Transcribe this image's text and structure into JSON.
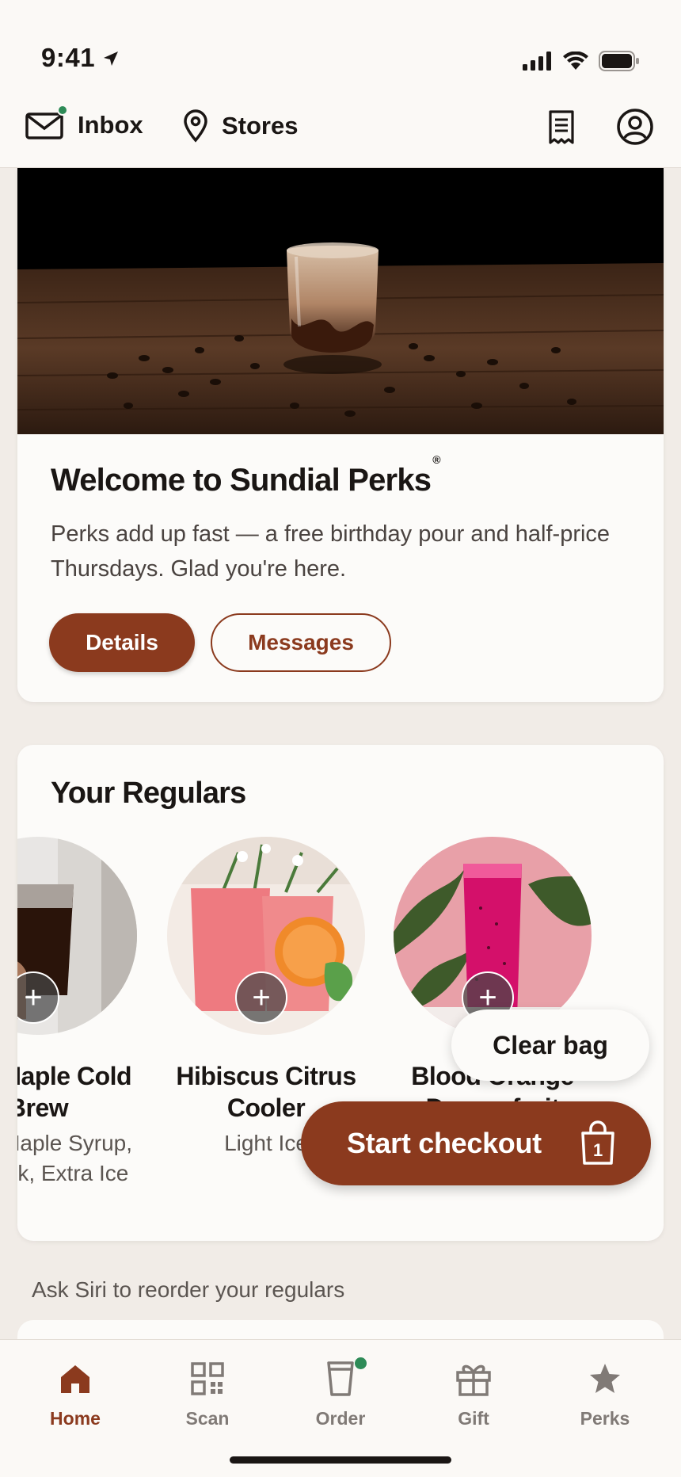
{
  "status_bar": {
    "time": "9:41"
  },
  "top_nav": {
    "inbox_label": "Inbox",
    "stores_label": "Stores"
  },
  "hero": {
    "title": "Welcome to Sundial Perks",
    "title_mark": "®",
    "body": "Perks add up fast — a free birthday pour and half-price Thursdays. Glad you're here.",
    "details_label": "Details",
    "messages_label": "Messages"
  },
  "regulars": {
    "title": "Your Regulars",
    "items": [
      {
        "name": "Iced Maple Cold Brew",
        "desc": "Extra Maple Syrup, Oat Milk, Extra Ice",
        "add_symbol": "+"
      },
      {
        "name": "Hibiscus Citrus Cooler",
        "desc": "Light Ice",
        "add_symbol": "+"
      },
      {
        "name": "Blood Orange Dragonfruit",
        "desc": "",
        "add_symbol": "+"
      }
    ]
  },
  "bag": {
    "clear_label": "Clear bag",
    "checkout_label": "Start checkout",
    "count": "1"
  },
  "siri_hint": "Ask Siri to reorder your regulars",
  "tab_bar": {
    "tabs": [
      {
        "label": "Home",
        "icon": "home-icon",
        "active": true
      },
      {
        "label": "Scan",
        "icon": "qr-icon"
      },
      {
        "label": "Order",
        "icon": "cup-icon"
      },
      {
        "label": "Gift",
        "icon": "gift-icon"
      },
      {
        "label": "Perks",
        "icon": "star-icon"
      }
    ]
  },
  "colors": {
    "accent": "#8b3a1e",
    "background": "#f1ece7",
    "card": "#fcfbf9",
    "notification_dot": "#2e8b57"
  }
}
